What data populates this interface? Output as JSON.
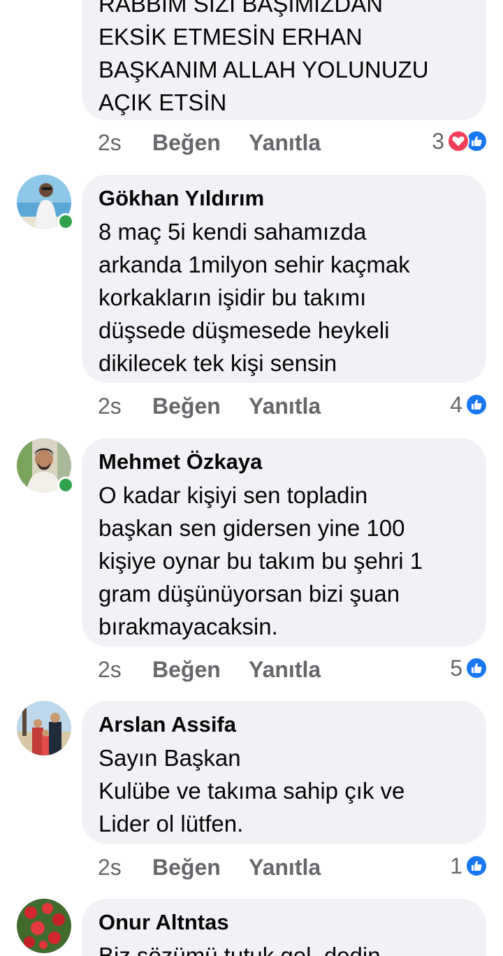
{
  "comments": [
    {
      "author": "",
      "text": "RABBİM SİZİ BAŞIMIZDAN\nEKSİK ETMESİN ERHAN\nBAŞKANIM ALLAH YOLUNUZU\nAÇIK ETSİN",
      "time": "2s",
      "like_label": "Beğen",
      "reply_label": "Yanıtla",
      "reaction_count": "3",
      "reactions": [
        "love-icon",
        "like-icon"
      ]
    },
    {
      "author": "Gökhan Yıldırım",
      "text": "8 maç 5i kendi sahamızda\narkanda 1milyon sehir kaçmak\nkorkakların işidir bu takımı\ndüşsede düşmesede heykeli\ndikilecek tek kişi sensin",
      "time": "2s",
      "like_label": "Beğen",
      "reply_label": "Yanıtla",
      "reaction_count": "4",
      "online": true
    },
    {
      "author": "Mehmet Özkaya",
      "text": "O kadar kişiyi sen topladin\nbaşkan sen gidersen yine 100\nkişiye oynar bu takım bu şehri 1\ngram düşünüyorsan bizi şuan\nbırakmayacaksin.",
      "time": "2s",
      "like_label": "Beğen",
      "reply_label": "Yanıtla",
      "reaction_count": "5",
      "online": true
    },
    {
      "author": "Arslan Assifa",
      "text": "Sayın Başkan\nKulübe ve takıma sahip çık ve\nLider ol lütfen.",
      "time": "2s",
      "like_label": "Beğen",
      "reply_label": "Yanıtla",
      "reaction_count": "1"
    },
    {
      "author": "Onur Altntas",
      "text": "Biz sözümü tutuk gel, dedin"
    }
  ],
  "colors": {
    "bubble": "#f0f2f5",
    "secondary_text": "#65676b",
    "like_blue": "#1877f2",
    "love_red": "#f33e58",
    "online_green": "#31a24c"
  }
}
